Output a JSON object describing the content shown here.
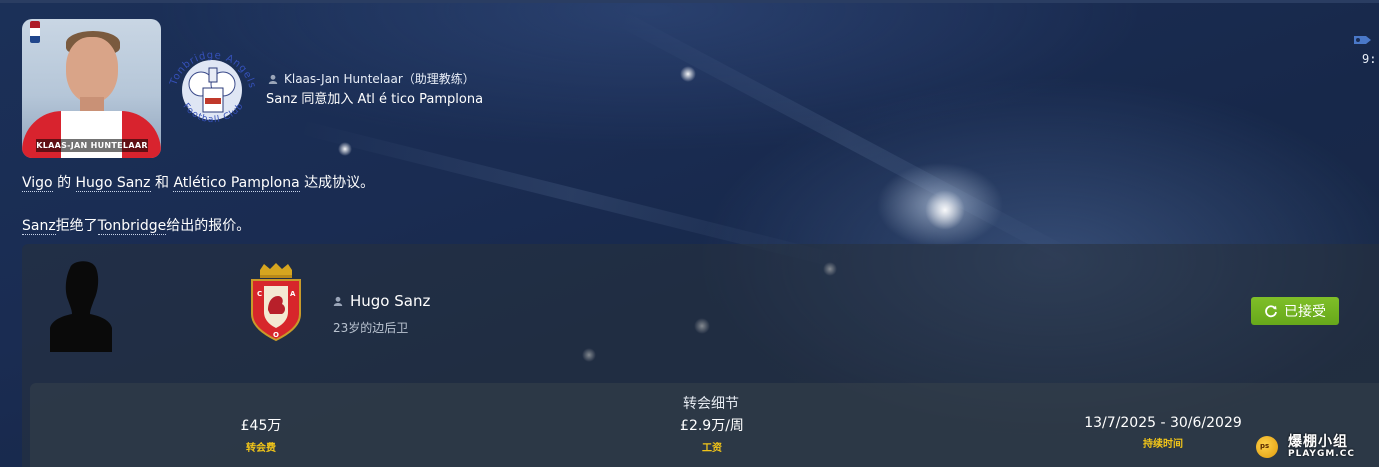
{
  "header": {
    "person_name": "Klaas-Jan Huntelaar（助理教练）",
    "headline": "Sanz 同意加入 Atl é tico Pamplona",
    "avatar_nameplate": "KLAAS-JAN HUNTELAAR",
    "badge_text": "Tonbridge Angels Football Club"
  },
  "news": {
    "line1": {
      "club": "Vigo",
      "t1": " 的 ",
      "player": "Hugo Sanz",
      "t2": " 和 ",
      "club2": "Atlético Pamplona",
      "t3": " 达成协议。"
    },
    "line2": {
      "player": "Sanz",
      "t1": "拒绝了",
      "club": "Tonbridge",
      "t2": "给出的报价。"
    }
  },
  "top_right": {
    "time": "9:"
  },
  "card": {
    "player_name": "Hugo Sanz",
    "player_desc": "23岁的边后卫",
    "status_button": "已接受",
    "club_badge_text": "C A O"
  },
  "transfer": {
    "title": "转会细节",
    "fee_value": "£45万",
    "fee_label": "转会费",
    "wage_value": "£2.9万/周",
    "wage_label": "工资",
    "duration_value": "13/7/2025 - 30/6/2029",
    "duration_label": "持续时间"
  },
  "watermark": {
    "title": "爆棚小组",
    "subtitle": "PLAYGM.CC",
    "badge": "ps"
  },
  "colors": {
    "accept_green": "#72b21f",
    "label_yellow": "#f0c419",
    "background": "#1a2c52"
  }
}
